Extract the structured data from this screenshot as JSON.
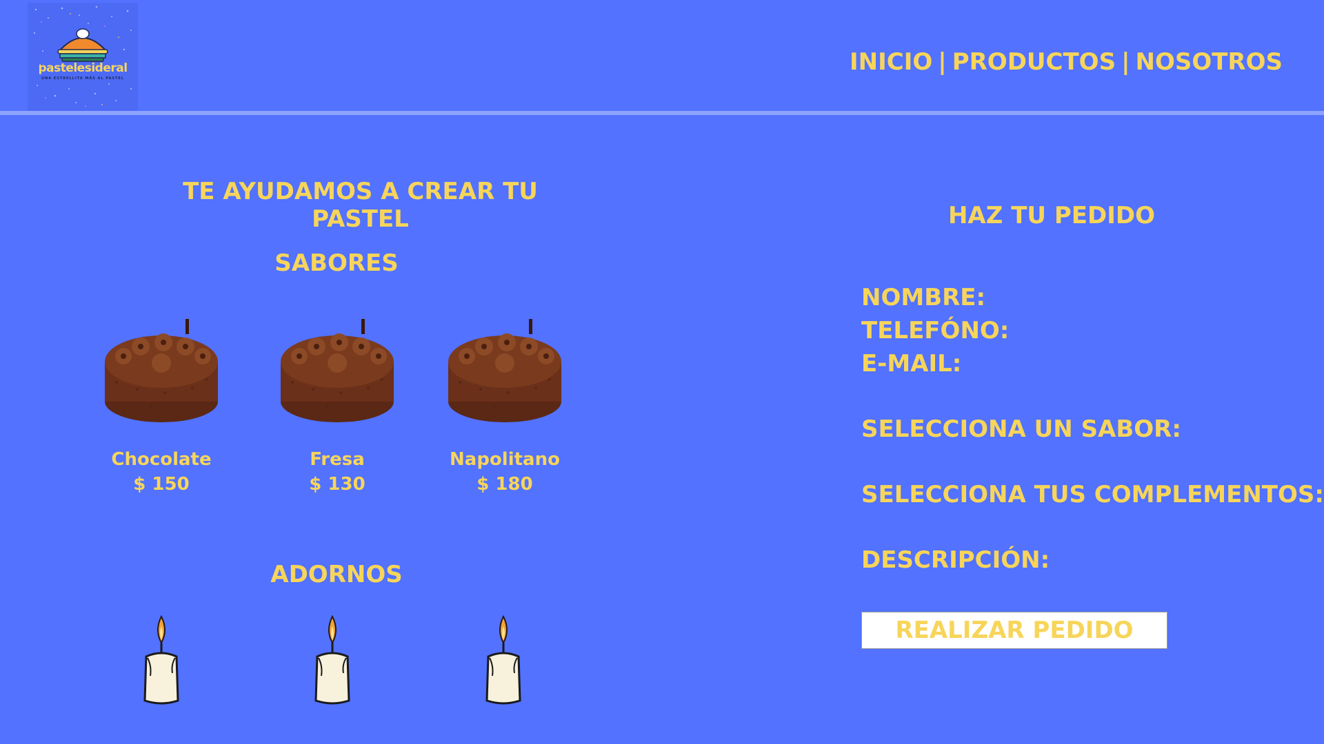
{
  "header": {
    "logo_name": "pastelesideral",
    "logo_tagline": "UNA ESTRELLITA MÁS AL PASTEL",
    "nav": [
      {
        "label": "INICIO"
      },
      {
        "label": "PRODUCTOS"
      },
      {
        "label": "NOSOTROS"
      }
    ],
    "separator": "|"
  },
  "left": {
    "title": "TE AYUDAMOS A CREAR TU PASTEL",
    "flavors_title": "SABORES",
    "flavors": [
      {
        "name": "Chocolate",
        "price": "$ 150",
        "icon": "chocolate-cake-icon"
      },
      {
        "name": "Fresa",
        "price": "$ 130",
        "icon": "chocolate-cake-icon"
      },
      {
        "name": "Napolitano",
        "price": "$ 180",
        "icon": "chocolate-cake-icon"
      }
    ],
    "decorations_title": "ADORNOS",
    "decorations": [
      {
        "icon": "candle-icon"
      },
      {
        "icon": "candle-icon"
      },
      {
        "icon": "candle-icon"
      }
    ]
  },
  "right": {
    "title": "HAZ TU PEDIDO",
    "fields": {
      "name": "NOMBRE:",
      "phone": "TELEFÓNO:",
      "email": "E-MAIL:",
      "flavor": "SELECCIONA UN SABOR:",
      "extras": "SELECCIONA TUS COMPLEMENTOS:",
      "description": "DESCRIPCIÓN:"
    },
    "submit_label": "REALIZAR PEDIDO"
  },
  "colors": {
    "background": "#5272ff",
    "accent_text": "#f7d55a",
    "button_bg": "#ffffff",
    "divider": "#8ea3ff"
  }
}
